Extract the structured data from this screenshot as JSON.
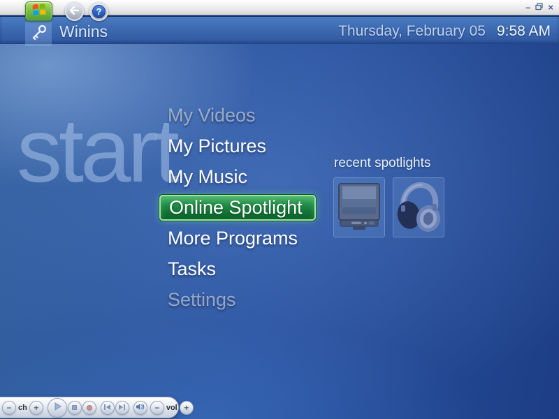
{
  "titlebar": {
    "start_button_icon": "windows-flag",
    "back_button_icon": "back-arrow",
    "help_label": "?",
    "minimize_label": "–",
    "restore_icon": "overlapping-windows",
    "close_label": "×"
  },
  "header": {
    "icon": "key",
    "title": "Winins",
    "date": "Thursday, February 05",
    "time": "9:58 AM"
  },
  "watermark": "start",
  "menu": {
    "selected_index": 3,
    "items": [
      {
        "label": "My Videos",
        "state": "dimmed"
      },
      {
        "label": "My Pictures",
        "state": "normal"
      },
      {
        "label": "My Music",
        "state": "normal"
      },
      {
        "label": "Online Spotlight",
        "state": "selected"
      },
      {
        "label": "More Programs",
        "state": "normal"
      },
      {
        "label": "Tasks",
        "state": "normal"
      },
      {
        "label": "Settings",
        "state": "dimmed"
      }
    ]
  },
  "spotlights": {
    "title": "recent spotlights",
    "items": [
      {
        "icon": "monitor-thumbnail"
      },
      {
        "icon": "headphones-thumbnail"
      }
    ]
  },
  "media_bar": {
    "channel": {
      "decrease": "−",
      "label": "ch",
      "increase": "+"
    },
    "transport": [
      "play",
      "stop",
      "record",
      "skip-back",
      "skip-forward"
    ],
    "mute_icon": "speaker",
    "volume": {
      "decrease": "−",
      "label": "vol",
      "increase": "+"
    }
  },
  "colors": {
    "selection_green": "#1a7f38",
    "selection_border": "#a4e4a4",
    "background_blue": "#2a52a0",
    "header_blue": "#3a66ad",
    "start_button_green": "#6cb33c",
    "record_red": "#d09090"
  }
}
